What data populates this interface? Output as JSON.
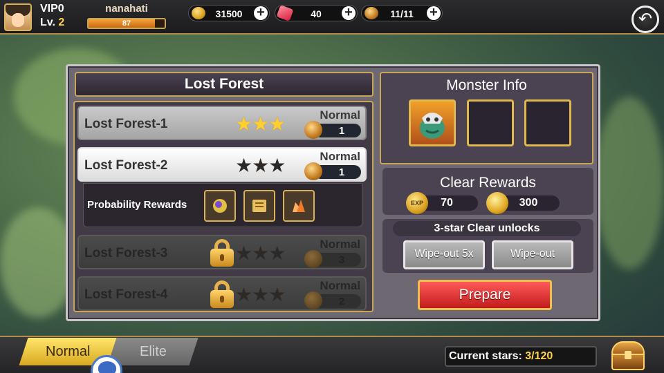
{
  "player": {
    "vip": "VIP0",
    "level_prefix": "Lv.",
    "level": "2",
    "name": "nanahati",
    "exp_value": "87",
    "exp_fraction": 0.87
  },
  "resources": [
    {
      "icon": "gold-coin-icon",
      "value": "31500"
    },
    {
      "icon": "ruby-gem-icon",
      "value": "40"
    },
    {
      "icon": "stamina-coin-icon",
      "value": "11/11"
    }
  ],
  "chapter": {
    "title": "Lost Forest",
    "stages": [
      {
        "name": "Lost Forest-1",
        "difficulty": "Normal",
        "cost": "1",
        "stars": 3,
        "state": "cleared"
      },
      {
        "name": "Lost Forest-2",
        "difficulty": "Normal",
        "cost": "1",
        "stars": 0,
        "state": "selected"
      },
      {
        "name": "Lost Forest-3",
        "difficulty": "Normal",
        "cost": "3",
        "stars": 0,
        "state": "locked"
      },
      {
        "name": "Lost Forest-4",
        "difficulty": "Normal",
        "cost": "2",
        "stars": 0,
        "state": "locked"
      }
    ],
    "probability_rewards_label": "Probability Rewards",
    "probability_rewards": [
      "orb-item-icon",
      "scroll-book-item-icon",
      "crystal-ore-item-icon"
    ]
  },
  "monster_info": {
    "title": "Monster Info",
    "slots": [
      "goblin-monster-portrait",
      "empty-slot",
      "empty-slot"
    ]
  },
  "clear_rewards": {
    "title": "Clear Rewards",
    "exp_icon_text": "EXP",
    "exp": "70",
    "gold": "300"
  },
  "unlocks": {
    "title": "3-star Clear unlocks",
    "wipe_out_5x": "Wipe-out 5x",
    "wipe_out": "Wipe-out"
  },
  "prepare_label": "Prepare",
  "tabs": {
    "normal": "Normal",
    "elite": "Elite"
  },
  "current_stars": {
    "label": "Current stars:",
    "value": "3/120"
  },
  "colors": {
    "gold_accent": "#c9a55a",
    "star_gold": "#ffcf2e",
    "prepare_red": "#d62a2a",
    "panel_purple": "#4b4352"
  }
}
